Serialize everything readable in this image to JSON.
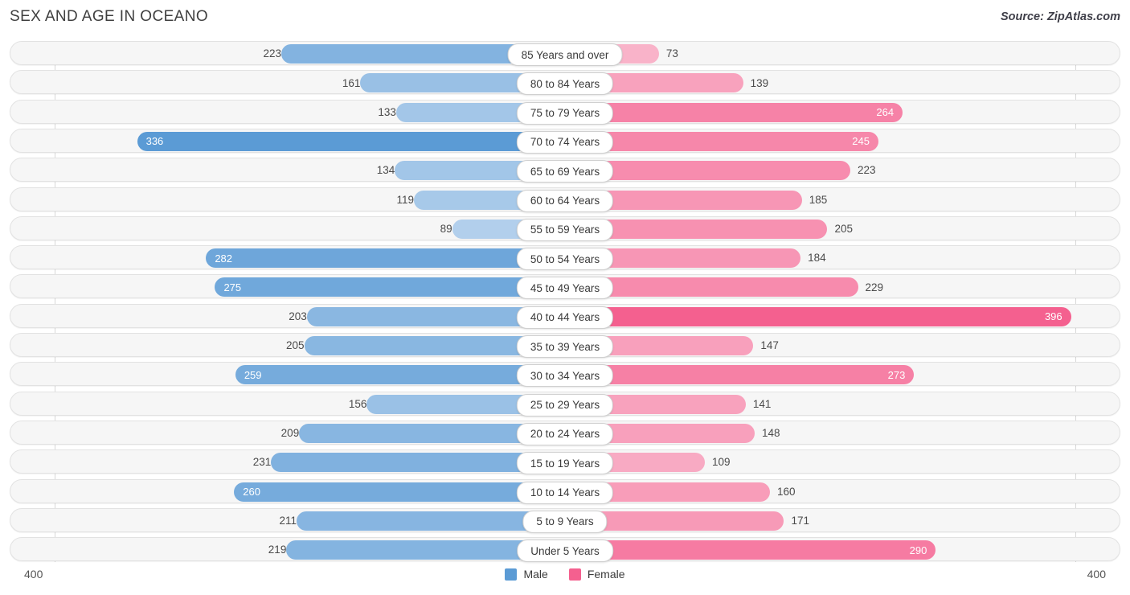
{
  "header": {
    "title": "SEX AND AGE IN OCEANO",
    "source": "Source: ZipAtlas.com"
  },
  "axis": {
    "left_label": "400",
    "right_label": "400"
  },
  "legend": {
    "items": [
      {
        "label": "Male",
        "color": "#5b9bd5",
        "icon": "male-color-swatch"
      },
      {
        "label": "Female",
        "color": "#f4608f",
        "icon": "female-color-swatch"
      }
    ]
  },
  "chart_data": {
    "type": "bar",
    "title": "SEX AND AGE IN OCEANO",
    "subtitle": "Source: ZipAtlas.com",
    "orientation": "horizontal-diverging",
    "xlabel": "",
    "ylabel": "",
    "axis_max": 400,
    "xlim": [
      400,
      400
    ],
    "grid": true,
    "legend_position": "bottom-center",
    "categories": [
      "85 Years and over",
      "80 to 84 Years",
      "75 to 79 Years",
      "70 to 74 Years",
      "65 to 69 Years",
      "60 to 64 Years",
      "55 to 59 Years",
      "50 to 54 Years",
      "45 to 49 Years",
      "40 to 44 Years",
      "35 to 39 Years",
      "30 to 34 Years",
      "25 to 29 Years",
      "20 to 24 Years",
      "15 to 19 Years",
      "10 to 14 Years",
      "5 to 9 Years",
      "Under 5 Years"
    ],
    "series": [
      {
        "name": "Male",
        "color": "#5b9bd5",
        "values": [
          223,
          161,
          133,
          336,
          134,
          119,
          89,
          282,
          275,
          203,
          205,
          259,
          156,
          209,
          231,
          260,
          211,
          219
        ]
      },
      {
        "name": "Female",
        "color": "#f4608f",
        "values": [
          73,
          139,
          264,
          245,
          223,
          185,
          205,
          184,
          229,
          396,
          147,
          273,
          141,
          148,
          109,
          160,
          171,
          290
        ]
      }
    ]
  }
}
